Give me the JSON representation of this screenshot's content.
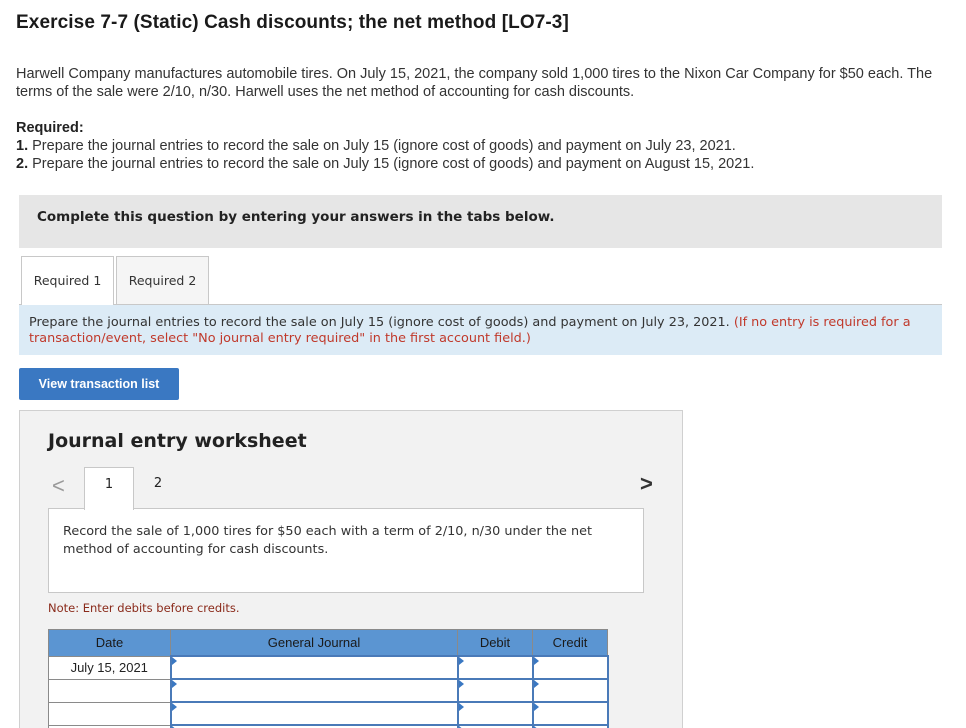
{
  "header": {
    "title": "Exercise 7-7 (Static) Cash discounts; the net method [LO7-3]"
  },
  "intro": {
    "text": "Harwell Company manufactures automobile tires. On July 15, 2021, the company sold 1,000 tires to the Nixon Car Company for $50 each. The terms of the sale were 2/10, n/30. Harwell uses the net method of accounting for cash discounts."
  },
  "required": {
    "heading": "Required:",
    "items": [
      {
        "num": "1.",
        "text": "Prepare the journal entries to record the sale on July 15 (ignore cost of goods) and payment on July 23, 2021."
      },
      {
        "num": "2.",
        "text": "Prepare the journal entries to record the sale on July 15 (ignore cost of goods) and payment on August 15, 2021."
      }
    ]
  },
  "instructions": "Complete this question by entering your answers in the tabs below.",
  "tabs": [
    {
      "label": "Required 1"
    },
    {
      "label": "Required 2"
    }
  ],
  "tab_panel": {
    "text": "Prepare the journal entries to record the sale on July 15 (ignore cost of goods) and payment on July 23, 2021.",
    "hint": "(If no entry is required for a transaction/event, select \"No journal entry required\" in the first account field.)"
  },
  "view_transaction_button": "View transaction list",
  "worksheet": {
    "title": "Journal entry worksheet",
    "prev_icon": "<",
    "next_icon": ">",
    "pages": [
      "1",
      "2"
    ],
    "record_text": "Record the sale of 1,000 tires for $50 each with a term of 2/10, n/30 under the net method of accounting for cash discounts.",
    "note": "Note: Enter debits before credits.",
    "table": {
      "headers": {
        "date": "Date",
        "general_journal": "General Journal",
        "debit": "Debit",
        "credit": "Credit"
      },
      "rows": [
        {
          "date": "July 15, 2021",
          "account": "",
          "debit": "",
          "credit": ""
        },
        {
          "date": "",
          "account": "",
          "debit": "",
          "credit": ""
        },
        {
          "date": "",
          "account": "",
          "debit": "",
          "credit": ""
        },
        {
          "date": "",
          "account": "",
          "debit": "",
          "credit": ""
        }
      ]
    }
  },
  "colors": {
    "button_blue": "#3a78c2",
    "table_header_blue": "#5b95d2",
    "panel_blue": "#dcebf6",
    "instructions_gray": "#e6e6e6",
    "hint_red": "#c0392b"
  }
}
